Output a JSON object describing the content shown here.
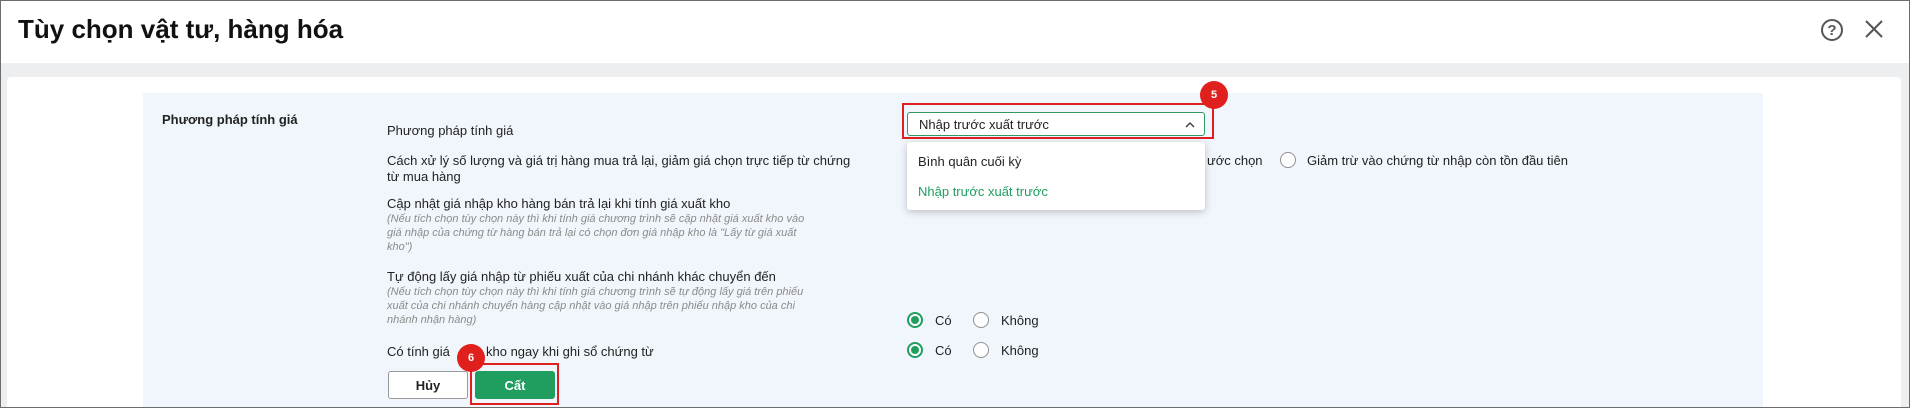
{
  "dialog": {
    "title": "Tùy chọn vật tư, hàng hóa",
    "help_label": "?"
  },
  "section": {
    "title": "Phương pháp tính giá"
  },
  "pricing_method": {
    "label": "Phương pháp tính giá",
    "selected": "Nhập trước xuất trước",
    "options": [
      "Bình quân cuối kỳ",
      "Nhập trước xuất trước"
    ]
  },
  "return_handling": {
    "label_line1": "Cách xử lý số lượng và giá trị hàng mua trả lại, giảm giá chọn trực tiếp từ chứng",
    "label_line2": "từ mua hàng",
    "option1_visible": "ước chọn",
    "option2": "Giảm trừ vào chứng từ nhập còn tồn đầu tiên"
  },
  "update_return_price": {
    "label": "Cập nhật giá nhập kho hàng bán trả lại khi tính giá xuất kho",
    "note_line1": "(Nếu tích chọn tùy chọn này thì khi tính giá chương trình sẽ cập nhật giá xuất kho vào",
    "note_line2": "giá nhập của chứng từ hàng bán trả lại có chọn đơn giá nhập kho là \"Lấy từ giá xuất",
    "note_line3": "kho\")"
  },
  "auto_transfer_price": {
    "label": "Tự động lấy giá nhập từ phiếu xuất của chi nhánh khác chuyển đến",
    "note_line1": "(Nếu tích chọn tùy chọn này thì khi tính giá chương trình sẽ tự động lấy giá trên phiếu",
    "note_line2": "xuất của chi nhánh chuyển hàng cập nhật vào giá nhập trên phiếu nhập kho của chi",
    "note_line3": "nhánh nhận hàng)",
    "yes": "Có",
    "no": "Không"
  },
  "calc_on_post": {
    "label_left": "Có tính giá",
    "label_right": "kho ngay khi ghi sổ chứng từ",
    "yes": "Có",
    "no": "Không"
  },
  "buttons": {
    "cancel": "Hủy",
    "save": "Cất"
  },
  "badges": {
    "step5": "5",
    "step6": "6"
  },
  "colors": {
    "accent": "#1f9e5f",
    "highlight": "#e02020"
  }
}
